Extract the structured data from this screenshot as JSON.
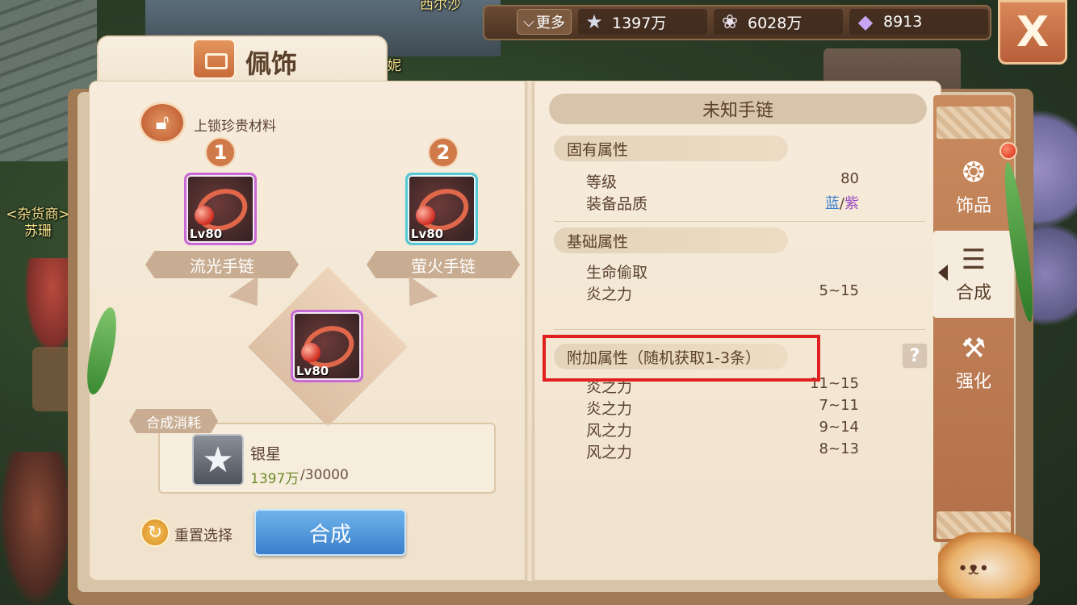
{
  "scene": {
    "npc_top": "西尔沙",
    "npc_partial": "妮",
    "npc_shop_role": "<杂货商>",
    "npc_shop_name": "苏珊"
  },
  "resources": {
    "more_label": "更多",
    "more_icon": "chevron-down-icon",
    "silver_star": {
      "icon": "star-icon",
      "value": "1397万"
    },
    "shell": {
      "icon": "shell-icon",
      "value": "6028万"
    },
    "gem": {
      "icon": "crystal-icon",
      "value": "8913"
    }
  },
  "close_label": "X",
  "panel": {
    "title": "佩饰",
    "title_icon": "bag-icon"
  },
  "lock_material": {
    "icon": "unlock-icon",
    "label": "上锁珍贵材料"
  },
  "slots": [
    {
      "number": "1",
      "level": "Lv80",
      "name": "流光手链",
      "quality_color": "#c86bd4"
    },
    {
      "number": "2",
      "level": "Lv80",
      "name": "萤火手链",
      "quality_color": "#56c8d6"
    }
  ],
  "result": {
    "level": "Lv80"
  },
  "cost": {
    "tag": "合成消耗",
    "item_name": "银星",
    "have": "1397万",
    "need": "/30000"
  },
  "actions": {
    "reset_label": "重置选择",
    "compose_label": "合成"
  },
  "detail": {
    "item_name": "未知手链",
    "innate": {
      "title": "固有属性",
      "level_label": "等级",
      "level_value": "80",
      "quality_label": "装备品质",
      "quality_blue": "蓝",
      "quality_sep": "/",
      "quality_purple": "紫"
    },
    "base": {
      "title": "基础属性",
      "rows": [
        {
          "k": "生命偷取",
          "v": ""
        },
        {
          "k": "炎之力",
          "v": "5~15"
        }
      ]
    },
    "extra": {
      "title": "附加属性（随机获取1-3条）",
      "help": "?",
      "rows": [
        {
          "k": "炎之力",
          "v": "11~15"
        },
        {
          "k": "炎之力",
          "v": "7~11"
        },
        {
          "k": "风之力",
          "v": "9~14"
        },
        {
          "k": "风之力",
          "v": "8~13"
        }
      ]
    }
  },
  "side_tabs": [
    {
      "label": "饰品",
      "icon": "accessory-icon",
      "active": false
    },
    {
      "label": "合成",
      "icon": "scroll-icon",
      "active": true
    },
    {
      "label": "强化",
      "icon": "hammer-icon",
      "active": false
    }
  ],
  "colors": {
    "accent": "#d07a4a",
    "compose_button": "#3a7fcb",
    "highlight_box": "#e02020",
    "quality_blue": "#3f82d2",
    "quality_purple": "#9a4cc4",
    "silver_have": "#6e8a2a"
  }
}
